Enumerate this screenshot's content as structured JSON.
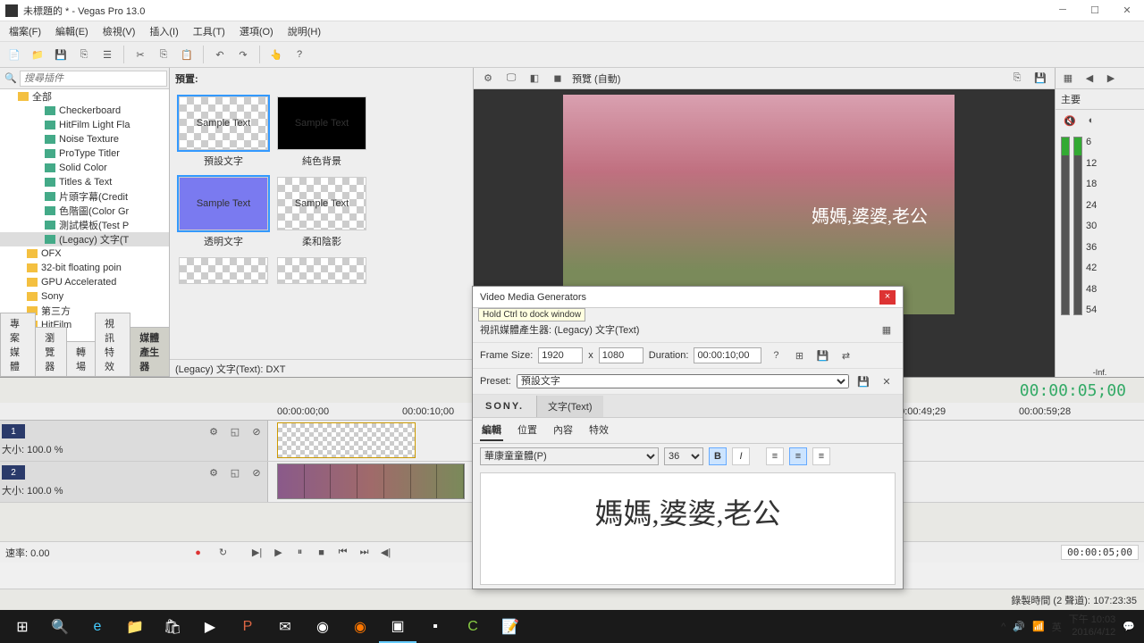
{
  "window": {
    "title": "未標題的 * - Vegas Pro 13.0"
  },
  "menu": [
    "檔案(F)",
    "編輯(E)",
    "檢視(V)",
    "插入(I)",
    "工具(T)",
    "選項(O)",
    "說明(H)"
  ],
  "search": {
    "placeholder": "搜尋插件"
  },
  "tree": {
    "root": "全部",
    "items": [
      "Checkerboard",
      "HitFilm Light Fla",
      "Noise Texture",
      "ProType Titler",
      "Solid Color",
      "Titles & Text",
      "片頭字幕(Credit",
      "色階圖(Color Gr",
      "測試模板(Test P",
      "(Legacy) 文字(T"
    ],
    "folders": [
      "OFX",
      "32-bit floating poin",
      "GPU Accelerated",
      "Sony",
      "第三方",
      "HitFilm"
    ]
  },
  "preset": {
    "header": "預置:",
    "items": [
      {
        "label": "預設文字",
        "text": "Sample Text",
        "style": "checker",
        "selected": true
      },
      {
        "label": "純色背景",
        "text": "Sample Text",
        "style": "black"
      },
      {
        "label": "透明文字",
        "text": "Sample Text",
        "style": "purple",
        "selected": true
      },
      {
        "label": "柔和陰影",
        "text": "Sample Text",
        "style": "checker"
      }
    ],
    "status": "(Legacy) 文字(Text): DXT"
  },
  "tabs": [
    "專案媒體",
    "瀏覽器",
    "轉場",
    "視訊特效",
    "媒體產生器"
  ],
  "preview": {
    "toolbar_label": "預覽 (自動)",
    "overlay_text": "媽媽,婆婆,老公"
  },
  "master": {
    "label": "主要",
    "inf": "-Inf.",
    "scale": [
      "6",
      "12",
      "18",
      "24",
      "30",
      "36",
      "42",
      "48",
      "54"
    ]
  },
  "timeline": {
    "current": "00:00:05;00",
    "marks": [
      "00:00:00;00",
      "00:00:10;00",
      "00:00:49;29",
      "00:00:59;28"
    ],
    "tracks": [
      {
        "num": "1",
        "level": "大小:  100.0 %"
      },
      {
        "num": "2",
        "level": "大小:  100.0 %"
      }
    ],
    "rate_label": "速率: 0.00",
    "pos": "00:00:05;00"
  },
  "generator": {
    "title": "Video Media Generators",
    "hint": "Hold Ctrl to dock window",
    "plugin_label": "視訊媒體產生器: (Legacy) 文字(Text)",
    "frame_label": "Frame Size:",
    "w": "1920",
    "x": "x",
    "h": "1080",
    "duration_label": "Duration:",
    "duration": "00:00:10;00",
    "preset_label": "Preset:",
    "preset_value": "預設文字",
    "sony": "SONY.",
    "tab": "文字(Text)",
    "edit_tabs": [
      "編輯",
      "位置",
      "內容",
      "特效"
    ],
    "font": "華康童童體(P)",
    "size": "36",
    "content": "媽媽,婆婆,老公"
  },
  "status": {
    "rec_label": "錄製時間 (2 聲道):",
    "rec_time": "107:23:35"
  },
  "tray": {
    "ime": "英",
    "time": "下午 10:03",
    "date": "2016/4/12"
  }
}
